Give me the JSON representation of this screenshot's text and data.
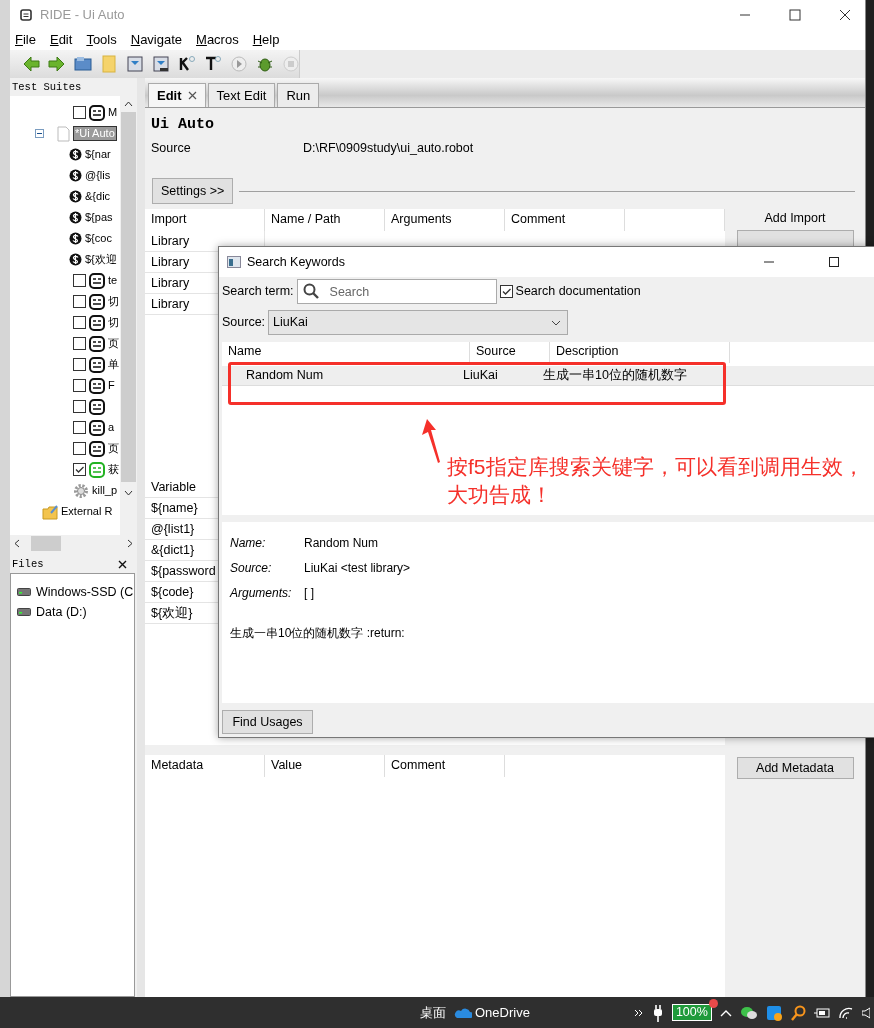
{
  "window": {
    "title": "RIDE - Ui Auto"
  },
  "menu": [
    {
      "label": "File"
    },
    {
      "label": "Edit"
    },
    {
      "label": "Tools"
    },
    {
      "label": "Navigate"
    },
    {
      "label": "Macros"
    },
    {
      "label": "Help"
    }
  ],
  "tree": {
    "title": "Test Suites",
    "items": [
      {
        "kind": "suite",
        "children": [
          {
            "kind": "test",
            "label": "M",
            "checked": false,
            "passed": false
          }
        ]
      },
      {
        "kind": "suite",
        "label": "*Ui Auto",
        "selected": true,
        "expanded": true,
        "children": [
          {
            "kind": "variable",
            "label": "${nar"
          },
          {
            "kind": "variable",
            "label": "@{lis"
          },
          {
            "kind": "variable",
            "label": "&{dic"
          },
          {
            "kind": "variable",
            "label": "${pas"
          },
          {
            "kind": "variable",
            "label": "${coc"
          },
          {
            "kind": "variable",
            "label": "${欢迎"
          },
          {
            "kind": "test",
            "label": "te",
            "checked": false,
            "passed": false
          },
          {
            "kind": "test",
            "label": "切",
            "checked": false,
            "passed": false
          },
          {
            "kind": "test",
            "label": "切",
            "checked": false,
            "passed": false
          },
          {
            "kind": "test",
            "label": "页",
            "checked": false,
            "passed": false
          },
          {
            "kind": "test",
            "label": "单",
            "checked": false,
            "passed": false
          },
          {
            "kind": "test",
            "label": "F",
            "checked": false,
            "passed": false
          },
          {
            "kind": "test",
            "checked": false,
            "passed": false
          },
          {
            "kind": "test",
            "label": "a",
            "checked": false,
            "passed": false
          },
          {
            "kind": "test",
            "label": "页",
            "checked": false,
            "passed": false
          },
          {
            "kind": "test",
            "label": "获",
            "checked": true,
            "passed": true
          },
          {
            "kind": "keyword",
            "label": "kill_p"
          }
        ]
      },
      {
        "kind": "resource",
        "label": "External R"
      }
    ]
  },
  "files": {
    "title": "Files",
    "items": [
      {
        "label": "Windows-SSD (C"
      },
      {
        "label": "Data (D:)"
      }
    ]
  },
  "tabs": [
    {
      "label": "Edit",
      "selected": true,
      "closable": true
    },
    {
      "label": "Text Edit",
      "selected": false,
      "closable": false
    },
    {
      "label": "Run",
      "selected": false,
      "closable": false
    }
  ],
  "suite": {
    "name": "Ui Auto",
    "source_label": "Source",
    "source": "D:\\RF\\0909study\\ui_auto.robot"
  },
  "settings_button": "Settings >>",
  "imports": {
    "columns": [
      "Import",
      "Name / Path",
      "Arguments",
      "Comment"
    ],
    "rows": [
      {
        "type": "Library"
      },
      {
        "type": "Library"
      },
      {
        "type": "Library"
      },
      {
        "type": "Library"
      }
    ],
    "add_label": "Add Import"
  },
  "variables": {
    "column": "Variable",
    "rows": [
      {
        "name": "${name}"
      },
      {
        "name": "@{list1}"
      },
      {
        "name": "&{dict1}"
      },
      {
        "name": "${password"
      },
      {
        "name": "${code}"
      },
      {
        "name": "${欢迎}"
      }
    ]
  },
  "metadata": {
    "columns": [
      "Metadata",
      "Value",
      "Comment"
    ],
    "add_button": "Add Metadata"
  },
  "dialog": {
    "title": "Search Keywords",
    "search_label": "Search term:",
    "search": {
      "placeholder": "Search"
    },
    "search_doc": {
      "label": "Search documentation",
      "checked": true
    },
    "source_label": "Source:",
    "source": "LiuKai",
    "columns": [
      "Name",
      "Source",
      "Description"
    ],
    "rows": [
      {
        "name": "Random Num",
        "source": "LiuKai",
        "description": "生成一串10位的随机数字",
        "selected": true
      }
    ],
    "details": [
      {
        "label": "Name:",
        "value": "Random Num"
      },
      {
        "label": "Source:",
        "value": "LiuKai <test library>"
      },
      {
        "label": "Arguments:",
        "value": "[ ]"
      }
    ],
    "doc": "生成一串10位的随机数字 :return:",
    "button": "Find Usages"
  },
  "annotation": {
    "text": "按f5指定库搜索关键字，可以看到调用生效，大功告成！"
  },
  "taskbar": {
    "items": [
      {
        "label": "桌面"
      },
      {
        "label": "OneDrive"
      }
    ],
    "battery": "100%"
  }
}
